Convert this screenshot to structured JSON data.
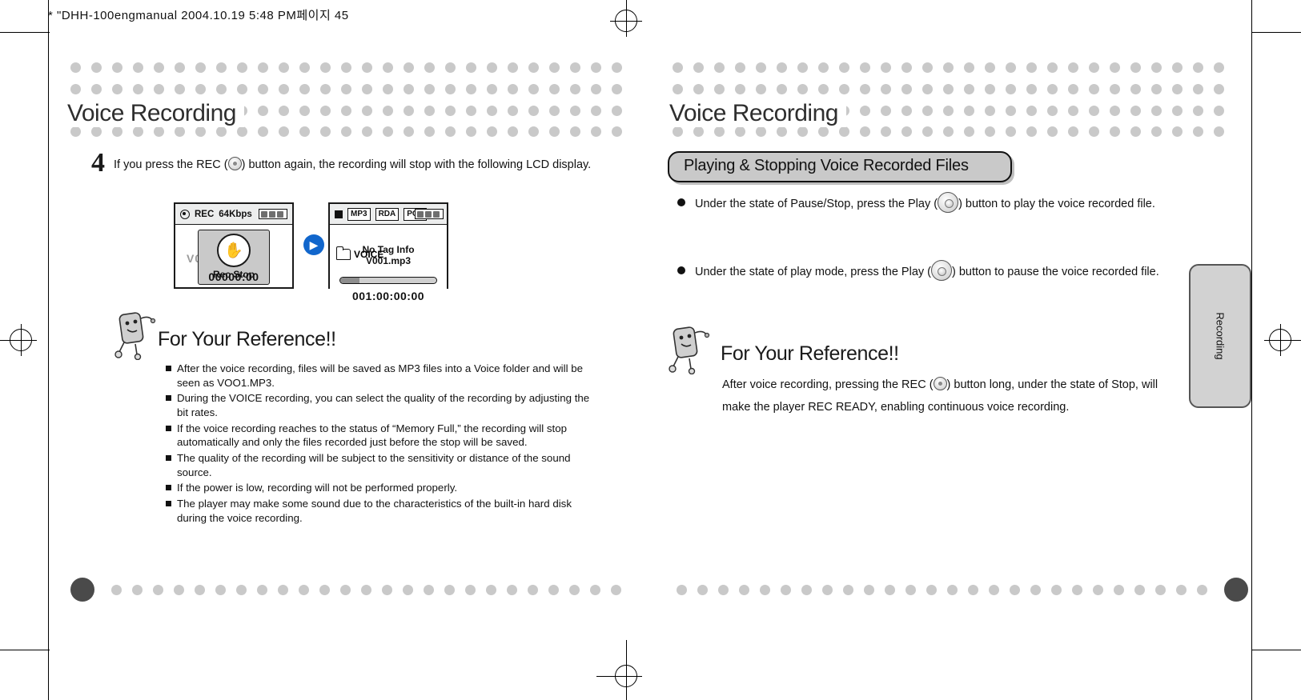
{
  "file_header": "* \"DHH-100engmanual  2004.10.19 5:48 PM페이지 45",
  "left_page": {
    "title": "Voice Recording",
    "step_number": "4",
    "step_text": "If you press the REC (   ) button again, the recording will stop with the following LCD display.",
    "lcd_1": {
      "status": "REC",
      "bitrate": "64Kbps",
      "ghost_text": "V001.mp3",
      "badge_label": "Rec Stop",
      "badge_icon": "✋",
      "time": "00000:00"
    },
    "lcd_2": {
      "tags": [
        "MP3",
        "RDA",
        "POP"
      ],
      "folder_label": "VOICE",
      "line_1": "No Tag Info",
      "line_2": "V001.mp3",
      "time": "001:00:00:00"
    },
    "reference": {
      "title": "For Your Reference!!",
      "items": [
        "After the voice recording, files will be saved as MP3 files into a Voice folder and will be seen as VOO1.MP3.",
        "During the VOICE recording, you can select the quality of the recording by adjusting the bit rates.",
        "If the voice recording reaches to the status of “Memory Full,” the recording will stop automatically and only the files recorded just before the stop will be saved.",
        "The quality of the recording will be subject to the sensitivity or distance of the sound source.",
        "If the power is low, recording will not be performed properly.",
        "The player may make some sound due to the characteristics of the built-in hard disk during the voice recording."
      ]
    }
  },
  "right_page": {
    "title": "Voice Recording",
    "banner": "Playing & Stopping Voice Recorded Files",
    "bullets": [
      "Under the state of Pause/Stop, press the Play (   ) button to play the voice recorded file.",
      "Under the state of play mode, press the Play (   ) button to pause the voice recorded file."
    ],
    "reference": {
      "title": "For Your Reference!!",
      "body": "After voice recording, pressing the REC (   ) button long, under the state of Stop, will make the player REC READY, enabling continuous voice recording."
    },
    "side_tab": "Recording"
  }
}
